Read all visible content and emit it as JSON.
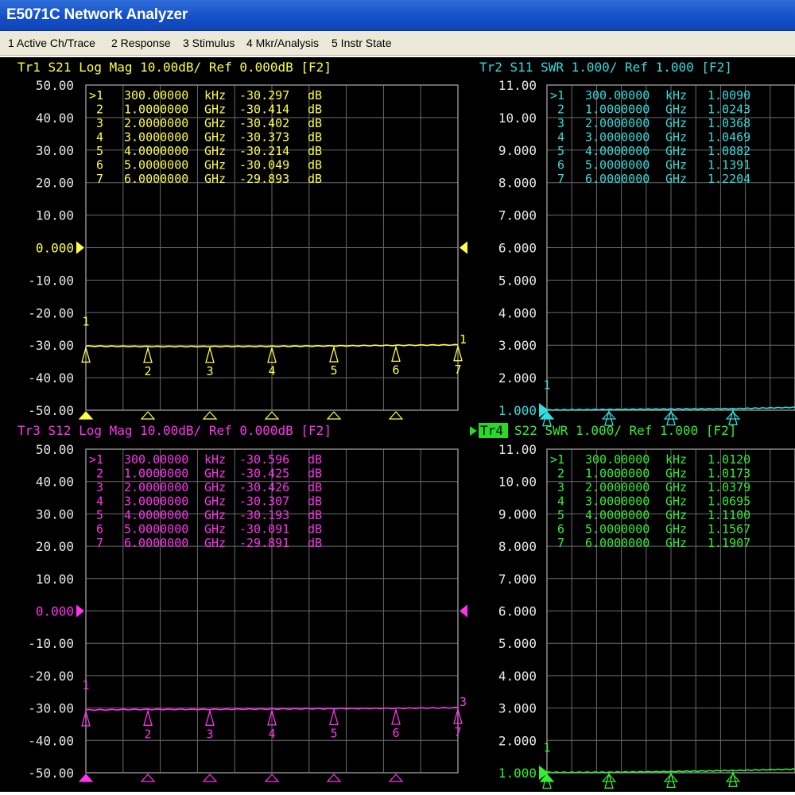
{
  "window": {
    "title": "E5071C Network Analyzer"
  },
  "menu": [
    {
      "label": "1 Active Ch/Trace"
    },
    {
      "label": "2 Response"
    },
    {
      "label": "3 Stimulus"
    },
    {
      "label": "4 Mkr/Analysis"
    },
    {
      "label": "5 Instr State"
    }
  ],
  "traces": [
    {
      "id": "tr1",
      "header": "Tr1 S21 Log Mag 10.00dB/ Ref 0.000dB [F2]",
      "color": "#ffff44",
      "ref_label": "0.000",
      "y_ticks": [
        "50.00",
        "40.00",
        "30.00",
        "20.00",
        "10.00",
        "0.000",
        "-10.00",
        "-20.00",
        "-30.00",
        "-40.00",
        "-50.00"
      ],
      "ylim": [
        -50,
        50
      ],
      "marker_table": [
        {
          "id": ">1",
          "freq": "300.00000",
          "unit": "kHz",
          "value": "-30.297",
          "vunit": "dB"
        },
        {
          "id": "2",
          "freq": "1.0000000",
          "unit": "GHz",
          "value": "-30.414",
          "vunit": "dB"
        },
        {
          "id": "3",
          "freq": "2.0000000",
          "unit": "GHz",
          "value": "-30.402",
          "vunit": "dB"
        },
        {
          "id": "4",
          "freq": "3.0000000",
          "unit": "GHz",
          "value": "-30.373",
          "vunit": "dB"
        },
        {
          "id": "5",
          "freq": "4.0000000",
          "unit": "GHz",
          "value": "-30.214",
          "vunit": "dB"
        },
        {
          "id": "6",
          "freq": "5.0000000",
          "unit": "GHz",
          "value": "-30.049",
          "vunit": "dB"
        },
        {
          "id": "7",
          "freq": "6.0000000",
          "unit": "GHz",
          "value": "-29.893",
          "vunit": "dB"
        }
      ],
      "markers": [
        {
          "label": "1",
          "x": 0,
          "y": -30.297
        },
        {
          "label": "2",
          "x": 1,
          "y": -30.414
        },
        {
          "label": "3",
          "x": 2,
          "y": -30.402
        },
        {
          "label": "4",
          "x": 3,
          "y": -30.373
        },
        {
          "label": "5",
          "x": 4,
          "y": -30.214
        },
        {
          "label": "6",
          "x": 5,
          "y": -30.049
        },
        {
          "label": "7",
          "x": 6,
          "y": -29.893
        }
      ],
      "end_label": "1"
    },
    {
      "id": "tr2",
      "header": "Tr2 S11 SWR 1.000/ Ref 1.000 [F2]",
      "color": "#33dddd",
      "ref_label": "1.000",
      "y_ticks": [
        "11.00",
        "10.00",
        "9.000",
        "8.000",
        "7.000",
        "6.000",
        "5.000",
        "4.000",
        "3.000",
        "2.000",
        "1.000"
      ],
      "ylim": [
        1,
        11
      ],
      "marker_table": [
        {
          "id": ">1",
          "freq": "300.00000",
          "unit": "kHz",
          "value": "1.0090",
          "vunit": ""
        },
        {
          "id": "2",
          "freq": "1.0000000",
          "unit": "GHz",
          "value": "1.0243",
          "vunit": ""
        },
        {
          "id": "3",
          "freq": "2.0000000",
          "unit": "GHz",
          "value": "1.0368",
          "vunit": ""
        },
        {
          "id": "4",
          "freq": "3.0000000",
          "unit": "GHz",
          "value": "1.0469",
          "vunit": ""
        },
        {
          "id": "5",
          "freq": "4.0000000",
          "unit": "GHz",
          "value": "1.0882",
          "vunit": ""
        },
        {
          "id": "6",
          "freq": "5.0000000",
          "unit": "GHz",
          "value": "1.1391",
          "vunit": ""
        },
        {
          "id": "7",
          "freq": "6.0000000",
          "unit": "GHz",
          "value": "1.2204",
          "vunit": ""
        }
      ],
      "markers": [
        {
          "label": "1",
          "x": 0,
          "y": 1.009
        },
        {
          "label": "",
          "x": 1,
          "y": 1.0243
        },
        {
          "label": "",
          "x": 2,
          "y": 1.0368
        },
        {
          "label": "",
          "x": 3,
          "y": 1.0469
        }
      ],
      "end_label": ""
    },
    {
      "id": "tr3",
      "header": "Tr3 S12 Log Mag 10.00dB/ Ref 0.000dB [F2]",
      "color": "#ff33ee",
      "ref_label": "0.000",
      "y_ticks": [
        "50.00",
        "40.00",
        "30.00",
        "20.00",
        "10.00",
        "0.000",
        "-10.00",
        "-20.00",
        "-30.00",
        "-40.00",
        "-50.00"
      ],
      "ylim": [
        -50,
        50
      ],
      "marker_table": [
        {
          "id": ">1",
          "freq": "300.00000",
          "unit": "kHz",
          "value": "-30.596",
          "vunit": "dB"
        },
        {
          "id": "2",
          "freq": "1.0000000",
          "unit": "GHz",
          "value": "-30.425",
          "vunit": "dB"
        },
        {
          "id": "3",
          "freq": "2.0000000",
          "unit": "GHz",
          "value": "-30.426",
          "vunit": "dB"
        },
        {
          "id": "4",
          "freq": "3.0000000",
          "unit": "GHz",
          "value": "-30.307",
          "vunit": "dB"
        },
        {
          "id": "5",
          "freq": "4.0000000",
          "unit": "GHz",
          "value": "-30.193",
          "vunit": "dB"
        },
        {
          "id": "6",
          "freq": "5.0000000",
          "unit": "GHz",
          "value": "-30.091",
          "vunit": "dB"
        },
        {
          "id": "7",
          "freq": "6.0000000",
          "unit": "GHz",
          "value": "-29.891",
          "vunit": "dB"
        }
      ],
      "markers": [
        {
          "label": "1",
          "x": 0,
          "y": -30.596
        },
        {
          "label": "2",
          "x": 1,
          "y": -30.425
        },
        {
          "label": "3",
          "x": 2,
          "y": -30.426
        },
        {
          "label": "4",
          "x": 3,
          "y": -30.307
        },
        {
          "label": "5",
          "x": 4,
          "y": -30.193
        },
        {
          "label": "6",
          "x": 5,
          "y": -30.091
        },
        {
          "label": "7",
          "x": 6,
          "y": -29.891
        }
      ],
      "end_label": "3"
    },
    {
      "id": "tr4",
      "header": "S22 SWR 1.000/ Ref 1.000 [F2]",
      "header_tag": "Tr4",
      "color": "#33ee33",
      "ref_label": "1.000",
      "y_ticks": [
        "11.00",
        "10.00",
        "9.000",
        "8.000",
        "7.000",
        "6.000",
        "5.000",
        "4.000",
        "3.000",
        "2.000",
        "1.000"
      ],
      "ylim": [
        1,
        11
      ],
      "marker_table": [
        {
          "id": ">1",
          "freq": "300.00000",
          "unit": "kHz",
          "value": "1.0120",
          "vunit": ""
        },
        {
          "id": "2",
          "freq": "1.0000000",
          "unit": "GHz",
          "value": "1.0173",
          "vunit": ""
        },
        {
          "id": "3",
          "freq": "2.0000000",
          "unit": "GHz",
          "value": "1.0379",
          "vunit": ""
        },
        {
          "id": "4",
          "freq": "3.0000000",
          "unit": "GHz",
          "value": "1.0695",
          "vunit": ""
        },
        {
          "id": "5",
          "freq": "4.0000000",
          "unit": "GHz",
          "value": "1.1100",
          "vunit": ""
        },
        {
          "id": "6",
          "freq": "5.0000000",
          "unit": "GHz",
          "value": "1.1567",
          "vunit": ""
        },
        {
          "id": "7",
          "freq": "6.0000000",
          "unit": "GHz",
          "value": "1.1907",
          "vunit": ""
        }
      ],
      "markers": [
        {
          "label": "1",
          "x": 0,
          "y": 1.012
        },
        {
          "label": "",
          "x": 1,
          "y": 1.0173
        },
        {
          "label": "",
          "x": 2,
          "y": 1.0379
        },
        {
          "label": "",
          "x": 3,
          "y": 1.0695
        }
      ],
      "end_label": ""
    }
  ]
}
